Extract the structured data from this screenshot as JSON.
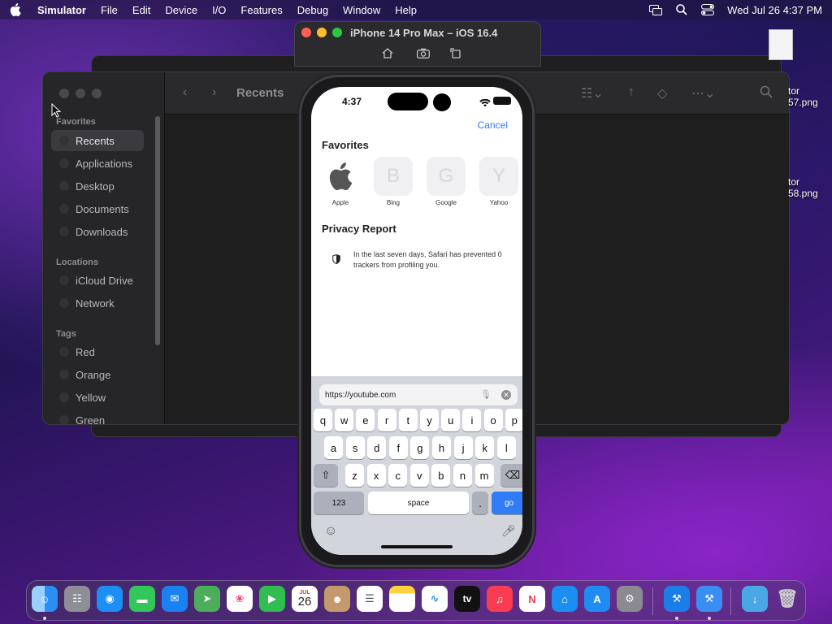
{
  "menubar": {
    "app": "Simulator",
    "menus": [
      "File",
      "Edit",
      "Device",
      "I/O",
      "Features",
      "Debug",
      "Window",
      "Help"
    ],
    "clock": "Wed Jul 26  4:37 PM"
  },
  "finder": {
    "back_title": "Downloads",
    "title": "Recents",
    "favorites_header": "Favorites",
    "favorites": [
      "Recents",
      "Applications",
      "Desktop",
      "Documents",
      "Downloads"
    ],
    "locations_header": "Locations",
    "locations": [
      "iCloud Drive",
      "Network"
    ],
    "tags_header": "Tags",
    "tags": [
      "Red",
      "Orange",
      "Yellow",
      "Green"
    ]
  },
  "desktop": {
    "file1_line1": "tor",
    "file1_line2": "57.png",
    "file2_line1": "tor",
    "file2_line2": "58.png"
  },
  "simulator": {
    "title": "iPhone 14 Pro Max – iOS 16.4"
  },
  "phone": {
    "time": "4:37",
    "cancel": "Cancel",
    "favorites_title": "Favorites",
    "favorites": [
      {
        "label": "Apple",
        "glyph": ""
      },
      {
        "label": "Bing",
        "glyph": "B"
      },
      {
        "label": "Google",
        "glyph": "G"
      },
      {
        "label": "Yahoo",
        "glyph": "Y"
      }
    ],
    "privacy_title": "Privacy Report",
    "privacy_text": "In the last seven days, Safari has prevented 0 trackers from profiling you.",
    "url": "https://youtube.com",
    "keys_row1": [
      "q",
      "w",
      "e",
      "r",
      "t",
      "y",
      "u",
      "i",
      "o",
      "p"
    ],
    "keys_row2": [
      "a",
      "s",
      "d",
      "f",
      "g",
      "h",
      "j",
      "k",
      "l"
    ],
    "keys_row3": [
      "z",
      "x",
      "c",
      "v",
      "b",
      "n",
      "m"
    ],
    "key_123": "123",
    "key_space": "space",
    "key_dot": ".",
    "key_go": "go"
  },
  "dock": {
    "calendar_month": "JUL",
    "calendar_day": "26",
    "tv_label": "tv"
  },
  "colors": {
    "accent": "#2f7cf6"
  }
}
